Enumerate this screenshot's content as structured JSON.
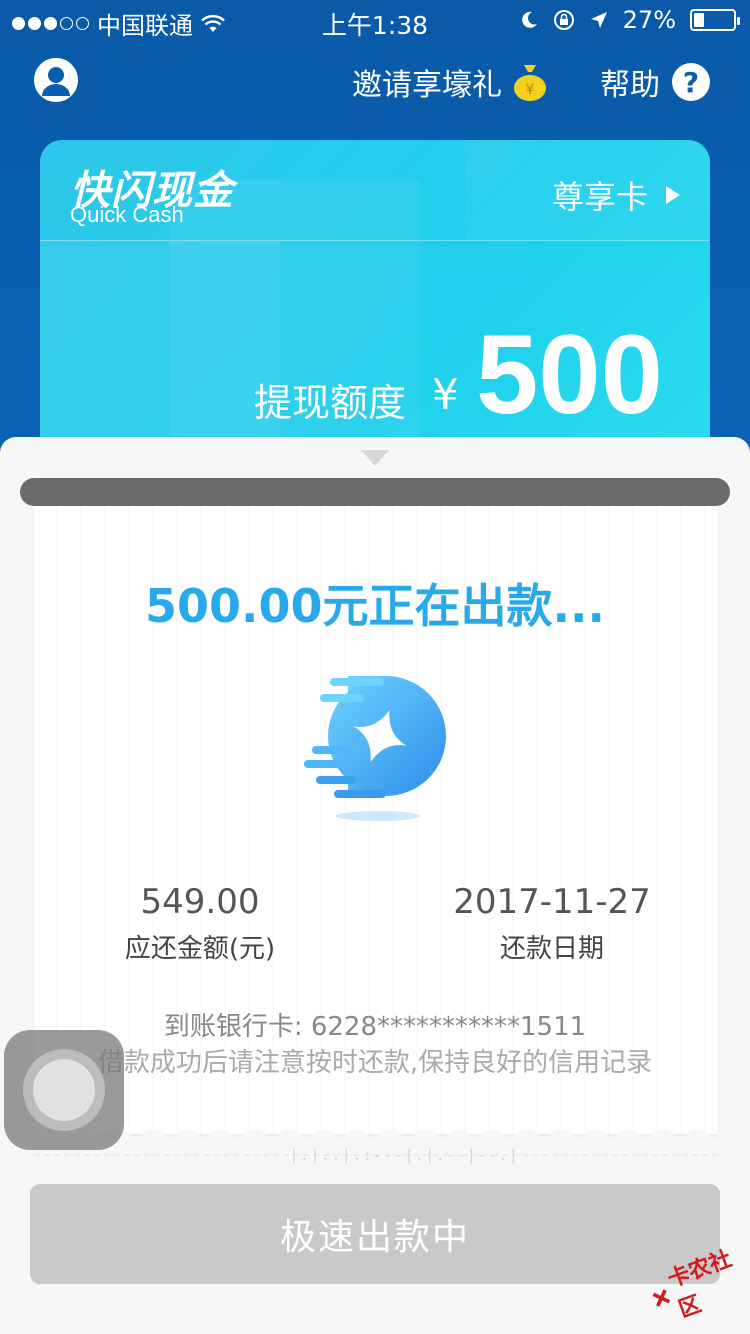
{
  "status_bar": {
    "carrier": "中国联通",
    "time": "上午1:38",
    "battery": "27%",
    "battery_level": 0.27
  },
  "header": {
    "invite_label": "邀请享壕礼",
    "help_label": "帮助",
    "help_symbol": "?"
  },
  "card": {
    "brand_cn": "快闪现金",
    "brand_en": "Quick Cash",
    "card_type": "尊享卡",
    "limit_label": "提现额度",
    "currency": "¥",
    "limit_amount": "500"
  },
  "receipt": {
    "status_title": "500.00元正在出款...",
    "amount_due_value": "549.00",
    "amount_due_label": "应还金额(元)",
    "due_date_value": "2017-11-27",
    "due_date_label": "还款日期",
    "bank_card": "到账银行卡: 6228***********1511",
    "notice": "借款成功后请注意按时还款,保持良好的信用记录"
  },
  "main_button": {
    "label": "极速出款中"
  },
  "watermark": {
    "label": "卡农社区"
  },
  "colors": {
    "primary_blue": "#0b5fb0",
    "card_cyan": "#2fc6ea",
    "title_blue": "#27a9ec",
    "button_disabled": "#c9c9c9"
  }
}
